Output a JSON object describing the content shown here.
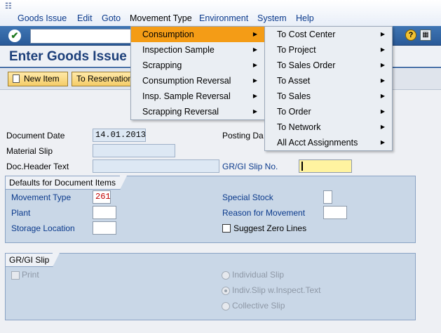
{
  "menubar": {
    "items": [
      {
        "label": "Goods Issue"
      },
      {
        "label": "Edit"
      },
      {
        "label": "Goto"
      },
      {
        "label": "Movement Type"
      },
      {
        "label": "Environment"
      },
      {
        "label": "System"
      },
      {
        "label": "Help"
      }
    ]
  },
  "toolbar": {
    "enter_icon": "check-icon",
    "command_field_value": "",
    "help_glyph": "?"
  },
  "page": {
    "title": "Enter Goods Issue"
  },
  "app_toolbar": {
    "new_item": "New Item",
    "to_reservation": "To Reservation"
  },
  "header_fields": {
    "document_date_label": "Document Date",
    "document_date_value": "14.01.2013",
    "posting_date_label": "Posting Da",
    "material_slip_label": "Material Slip",
    "material_slip_value": "",
    "doc_header_text_label": "Doc.Header Text",
    "doc_header_text_value": "",
    "gr_gi_slip_no_label": "GR/GI Slip No.",
    "gr_gi_slip_no_value": ""
  },
  "defaults_group": {
    "title": "Defaults for Document Items",
    "movement_type_label": "Movement Type",
    "movement_type_value": "261",
    "plant_label": "Plant",
    "plant_value": "",
    "storage_location_label": "Storage Location",
    "storage_location_value": "",
    "special_stock_label": "Special Stock",
    "special_stock_value": "",
    "reason_label": "Reason for Movement",
    "reason_value": "",
    "suggest_zero_lines_label": "Suggest Zero Lines"
  },
  "slip_group": {
    "title": "GR/GI Slip",
    "print_label": "Print",
    "individual_slip_label": "Individual Slip",
    "indiv_slip_inspect_label": "Indiv.Slip w.Inspect.Text",
    "collective_slip_label": "Collective Slip"
  },
  "movement_type_menu": {
    "items": [
      {
        "label": "Consumption"
      },
      {
        "label": "Inspection Sample"
      },
      {
        "label": "Scrapping"
      },
      {
        "label": "Consumption Reversal"
      },
      {
        "label": "Insp. Sample Reversal"
      },
      {
        "label": "Scrapping Reversal"
      }
    ],
    "highlight_color": "#f49c16"
  },
  "consumption_submenu": {
    "items": [
      {
        "label": "To Cost Center"
      },
      {
        "label": "To Project"
      },
      {
        "label": "To Sales Order"
      },
      {
        "label": "To Asset"
      },
      {
        "label": "To Sales"
      },
      {
        "label": "To Order"
      },
      {
        "label": "To Network"
      },
      {
        "label": "All Acct Assignments"
      }
    ]
  },
  "colors": {
    "toolbar_blue": "#2f63a3",
    "title_blue": "#1c3f7a",
    "group_bg": "#c9d7e7"
  }
}
